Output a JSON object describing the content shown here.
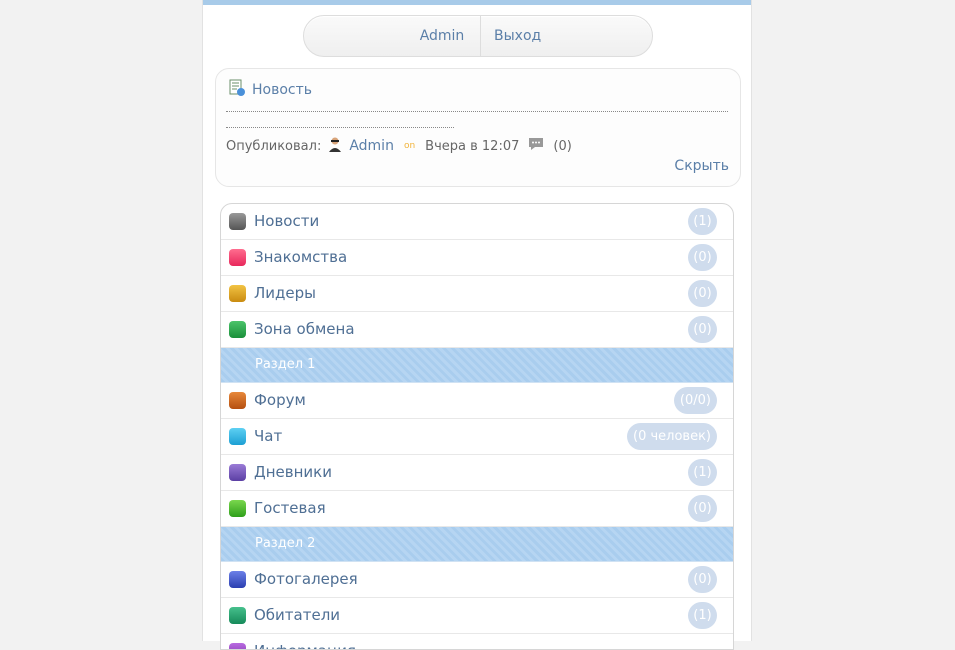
{
  "userbar": {
    "admin_label": "Admin",
    "logout_label": "Выход"
  },
  "news": {
    "title": "Новость",
    "author_prefix": "Опубликовал:",
    "author": "Admin",
    "online": "on",
    "date": "Вчера в 12:07",
    "comments_count": "(0)",
    "hide_label": "Скрыть"
  },
  "menu": {
    "items": [
      {
        "label": "Новости",
        "count": "(1)",
        "icon": "news-icon"
      },
      {
        "label": "Знакомства",
        "count": "(0)",
        "icon": "heart-icon"
      },
      {
        "label": "Лидеры",
        "count": "(0)",
        "icon": "trophy-icon"
      },
      {
        "label": "Зона обмена",
        "count": "(0)",
        "icon": "exchange-icon"
      }
    ],
    "section1": "Раздел 1",
    "items2": [
      {
        "label": "Форум",
        "count": "(0/0)",
        "icon": "pencil-icon"
      },
      {
        "label": "Чат",
        "count": "(0 человек)",
        "icon": "chat-cloud-icon"
      },
      {
        "label": "Дневники",
        "count": "(1)",
        "icon": "diary-icon"
      },
      {
        "label": "Гостевая",
        "count": "(0)",
        "icon": "guestbook-icon"
      }
    ],
    "section2": "Раздел 2",
    "items3": [
      {
        "label": "Фотогалерея",
        "count": "(0)",
        "icon": "camera-icon"
      },
      {
        "label": "Обитатели",
        "count": "(1)",
        "icon": "users-icon"
      },
      {
        "label": "Информация",
        "count": "",
        "icon": "info-icon"
      }
    ]
  }
}
